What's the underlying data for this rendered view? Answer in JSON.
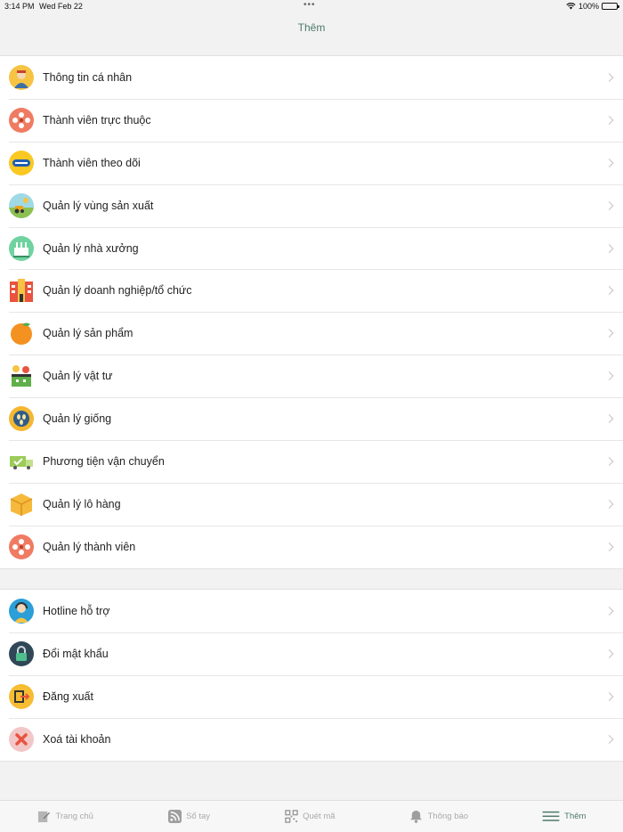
{
  "status_bar": {
    "time": "3:14 PM",
    "date": "Wed Feb 22",
    "battery": "100%",
    "dots": "•••"
  },
  "header": {
    "title": "Thêm"
  },
  "menu_main": [
    {
      "label": "Thông tin cá nhân",
      "icon": "profile-icon",
      "color": "#f6c343"
    },
    {
      "label": "Thành viên trực thuộc",
      "icon": "members-network-icon",
      "color": "#f07b63"
    },
    {
      "label": "Thành viên theo dõi",
      "icon": "follow-badge-icon",
      "color": "#f9c823"
    },
    {
      "label": "Quản lý vùng sản xuất",
      "icon": "farm-tractor-icon",
      "color": "#9fd9e6"
    },
    {
      "label": "Quản lý nhà xưởng",
      "icon": "factory-icon",
      "color": "#6fd3a0"
    },
    {
      "label": "Quản lý doanh nghiệp/tổ chức",
      "icon": "office-building-icon",
      "color": "#e9533f"
    },
    {
      "label": "Quản lý sản phẩm",
      "icon": "orange-fruit-icon",
      "color": "#f39221"
    },
    {
      "label": "Quản lý vật tư",
      "icon": "supply-basket-icon",
      "color": "#5fb04a"
    },
    {
      "label": "Quản lý giống",
      "icon": "seed-icon",
      "color": "#f4b730"
    },
    {
      "label": "Phương tiện vận chuyển",
      "icon": "delivery-truck-icon",
      "color": "#9ccb5a"
    },
    {
      "label": "Quản lý lô hàng",
      "icon": "package-box-icon",
      "color": "#f6b93b"
    },
    {
      "label": "Quản lý thành viên",
      "icon": "members-network-icon",
      "color": "#f07b63"
    }
  ],
  "menu_support": [
    {
      "label": "Hotline hỗ trợ",
      "icon": "support-agent-icon",
      "color": "#2a9fd8"
    },
    {
      "label": "Đổi mật khẩu",
      "icon": "lock-icon",
      "color": "#2f4756"
    },
    {
      "label": "Đăng xuất",
      "icon": "logout-icon",
      "color": "#f6bd32"
    },
    {
      "label": "Xoá tài khoản",
      "icon": "delete-x-icon",
      "color": "#f3c7c7"
    }
  ],
  "tabbar": [
    {
      "label": "Trang chủ",
      "icon": "home-edit-icon",
      "active": false
    },
    {
      "label": "Sổ tay",
      "icon": "rss-notebook-icon",
      "active": false
    },
    {
      "label": "Quét mã",
      "icon": "qr-scan-icon",
      "active": false
    },
    {
      "label": "Thông báo",
      "icon": "bell-icon",
      "active": false
    },
    {
      "label": "Thêm",
      "icon": "menu-lines-icon",
      "active": true
    }
  ],
  "colors": {
    "accent": "#4e7a6a",
    "background": "#f2f2f2"
  }
}
